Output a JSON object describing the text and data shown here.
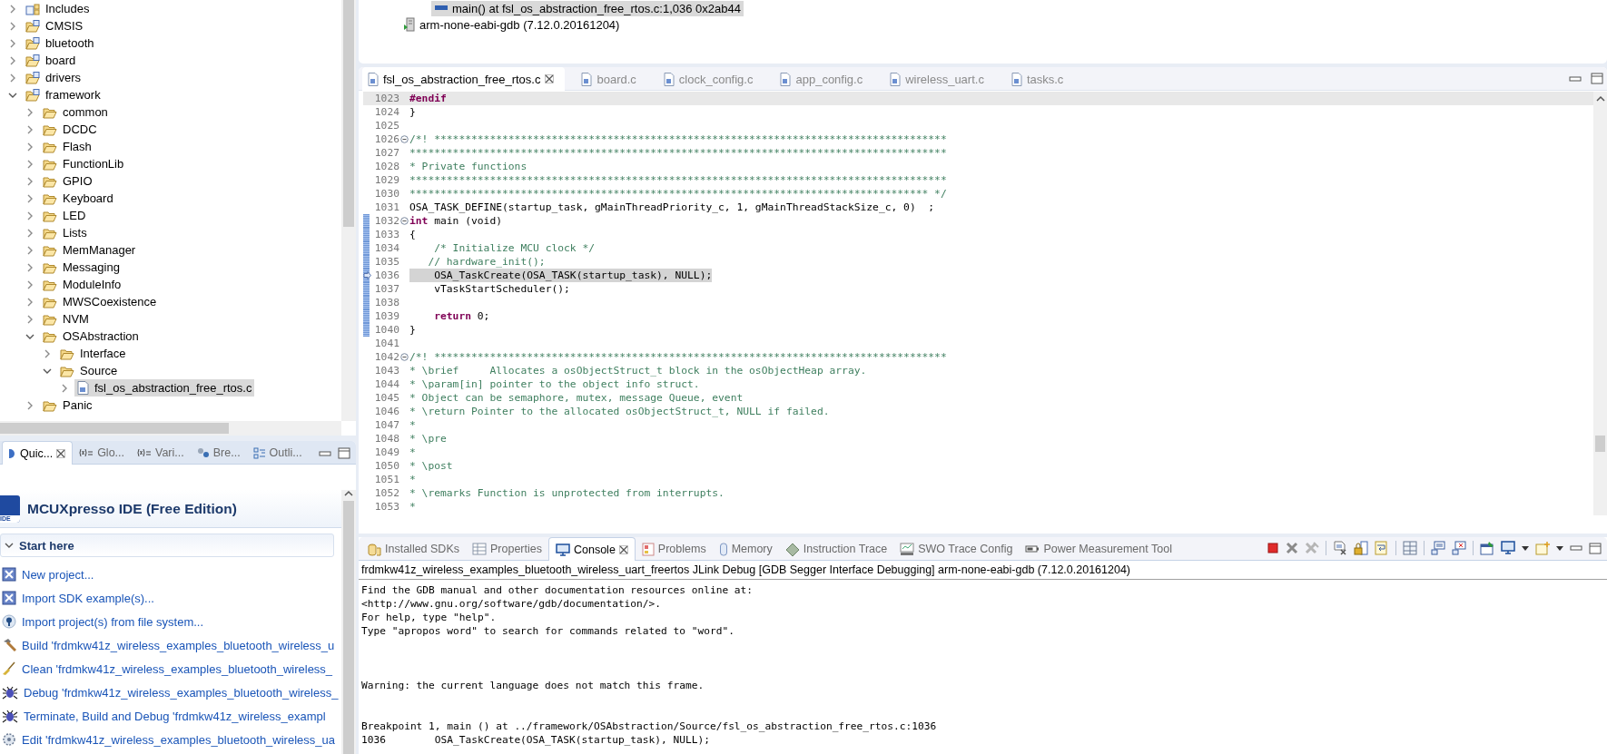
{
  "project_explorer": {
    "items": [
      {
        "label": "Includes",
        "kind": "includes",
        "expanded": false,
        "selected": false
      },
      {
        "label": "CMSIS",
        "kind": "source-folder",
        "expanded": false,
        "selected": false
      },
      {
        "label": "bluetooth",
        "kind": "source-folder",
        "expanded": false,
        "selected": false
      },
      {
        "label": "board",
        "kind": "source-folder",
        "expanded": false,
        "selected": false
      },
      {
        "label": "drivers",
        "kind": "source-folder",
        "expanded": false,
        "selected": false
      },
      {
        "label": "framework",
        "kind": "source-folder",
        "expanded": true,
        "selected": false,
        "children": [
          {
            "label": "common",
            "kind": "folder",
            "expanded": false,
            "selected": false
          },
          {
            "label": "DCDC",
            "kind": "folder",
            "expanded": false,
            "selected": false
          },
          {
            "label": "Flash",
            "kind": "folder",
            "expanded": false,
            "selected": false
          },
          {
            "label": "FunctionLib",
            "kind": "folder",
            "expanded": false,
            "selected": false
          },
          {
            "label": "GPIO",
            "kind": "folder",
            "expanded": false,
            "selected": false
          },
          {
            "label": "Keyboard",
            "kind": "folder",
            "expanded": false,
            "selected": false
          },
          {
            "label": "LED",
            "kind": "folder",
            "expanded": false,
            "selected": false
          },
          {
            "label": "Lists",
            "kind": "folder",
            "expanded": false,
            "selected": false
          },
          {
            "label": "MemManager",
            "kind": "folder",
            "expanded": false,
            "selected": false
          },
          {
            "label": "Messaging",
            "kind": "folder",
            "expanded": false,
            "selected": false
          },
          {
            "label": "ModuleInfo",
            "kind": "folder",
            "expanded": false,
            "selected": false
          },
          {
            "label": "MWSCoexistence",
            "kind": "folder",
            "expanded": false,
            "selected": false
          },
          {
            "label": "NVM",
            "kind": "folder",
            "expanded": false,
            "selected": false
          },
          {
            "label": "OSAbstraction",
            "kind": "folder",
            "expanded": true,
            "selected": false,
            "children": [
              {
                "label": "Interface",
                "kind": "folder",
                "expanded": false,
                "selected": false
              },
              {
                "label": "Source",
                "kind": "folder",
                "expanded": true,
                "selected": false,
                "children": [
                  {
                    "label": "fsl_os_abstraction_free_rtos.c",
                    "kind": "file",
                    "expanded": false,
                    "selected": true
                  }
                ]
              }
            ]
          },
          {
            "label": "Panic",
            "kind": "folder",
            "expanded": false,
            "selected": false
          }
        ]
      }
    ]
  },
  "side_views": {
    "tabs": [
      {
        "label": "Quic...",
        "kind": "quickstart",
        "selected": true
      },
      {
        "label": "Glo...",
        "kind": "variables",
        "selected": false
      },
      {
        "label": "Vari...",
        "kind": "variables",
        "selected": false
      },
      {
        "label": "Bre...",
        "kind": "breakpoints",
        "selected": false
      },
      {
        "label": "Outli...",
        "kind": "outline",
        "selected": false
      }
    ]
  },
  "quick_start": {
    "logo_text": "IDE",
    "title": "MCUXpresso IDE (Free Edition)",
    "section": "Start here",
    "section_expanded": true,
    "actions": [
      {
        "label": "New project...",
        "kind": "new"
      },
      {
        "label": "Import SDK example(s)...",
        "kind": "new"
      },
      {
        "label": "Import project(s) from file system...",
        "kind": "import"
      },
      {
        "label": "Build 'frdmkw41z_wireless_examples_bluetooth_wireless_u",
        "kind": "build"
      },
      {
        "label": "Clean 'frdmkw41z_wireless_examples_bluetooth_wireless_",
        "kind": "clean"
      },
      {
        "label": "Debug 'frdmkw41z_wireless_examples_bluetooth_wireless_",
        "kind": "debug"
      },
      {
        "label": "Terminate, Build and Debug 'frdmkw41z_wireless_exampl",
        "kind": "debug"
      },
      {
        "label": "Edit 'frdmkw41z_wireless_examples_bluetooth_wireless_ua",
        "kind": "edit"
      }
    ]
  },
  "debug_view": {
    "rows": [
      {
        "label": "main() at fsl_os_abstraction_free_rtos.c:1,036 0x2ab44",
        "kind": "frame",
        "selected": true
      },
      {
        "label": "arm-none-eabi-gdb (7.12.0.20161204)",
        "kind": "gdb",
        "selected": false
      }
    ]
  },
  "editor": {
    "tabs": [
      {
        "label": "fsl_os_abstraction_free_rtos.c",
        "selected": true
      },
      {
        "label": "board.c",
        "selected": false
      },
      {
        "label": "clock_config.c",
        "selected": false
      },
      {
        "label": "app_config.c",
        "selected": false
      },
      {
        "label": "wireless_uart.c",
        "selected": false
      },
      {
        "label": "tasks.c",
        "selected": false
      }
    ],
    "lines": [
      {
        "number": "1023",
        "fold": false,
        "current_line": true,
        "in_range": false,
        "instruction_pointer": false,
        "segments": [
          {
            "kind": "preproc",
            "text": "#endif"
          }
        ]
      },
      {
        "number": "1024",
        "fold": false,
        "current_line": false,
        "in_range": false,
        "instruction_pointer": false,
        "segments": [
          {
            "kind": "code",
            "text": "}"
          }
        ]
      },
      {
        "number": "1025",
        "fold": false,
        "current_line": false,
        "in_range": false,
        "instruction_pointer": false
      },
      {
        "number": "1026",
        "fold": true,
        "current_line": false,
        "in_range": false,
        "instruction_pointer": false,
        "segments": [
          {
            "kind": "comment",
            "text": "/*! ***********************************************************************************"
          }
        ]
      },
      {
        "number": "1027",
        "fold": false,
        "current_line": false,
        "in_range": false,
        "instruction_pointer": false,
        "segments": [
          {
            "kind": "comment",
            "text": "***************************************************************************************"
          }
        ]
      },
      {
        "number": "1028",
        "fold": false,
        "current_line": false,
        "in_range": false,
        "instruction_pointer": false,
        "segments": [
          {
            "kind": "comment",
            "text": "* Private functions"
          }
        ]
      },
      {
        "number": "1029",
        "fold": false,
        "current_line": false,
        "in_range": false,
        "instruction_pointer": false,
        "segments": [
          {
            "kind": "comment",
            "text": "***************************************************************************************"
          }
        ]
      },
      {
        "number": "1030",
        "fold": false,
        "current_line": false,
        "in_range": false,
        "instruction_pointer": false,
        "segments": [
          {
            "kind": "comment",
            "text": "************************************************************************************ */"
          }
        ]
      },
      {
        "number": "1031",
        "fold": false,
        "current_line": false,
        "in_range": false,
        "instruction_pointer": false,
        "segments": [
          {
            "kind": "code",
            "text": "OSA_TASK_DEFINE(startup_task, gMainThreadPriority_c, 1, gMainThreadStackSize_c, 0)  ;"
          }
        ]
      },
      {
        "number": "1032",
        "fold": true,
        "current_line": false,
        "in_range": true,
        "instruction_pointer": false,
        "segments": [
          {
            "kind": "keyword",
            "text": "int"
          },
          {
            "kind": "code",
            "text": " main (void)"
          }
        ]
      },
      {
        "number": "1033",
        "fold": false,
        "current_line": false,
        "in_range": true,
        "instruction_pointer": false,
        "segments": [
          {
            "kind": "code",
            "text": "{"
          }
        ]
      },
      {
        "number": "1034",
        "fold": false,
        "current_line": false,
        "in_range": true,
        "instruction_pointer": false,
        "segments": [
          {
            "kind": "comment",
            "text": "    /* Initialize MCU clock */"
          }
        ]
      },
      {
        "number": "1035",
        "fold": false,
        "current_line": false,
        "in_range": true,
        "instruction_pointer": false,
        "segments": [
          {
            "kind": "comment",
            "text": "   // hardware_init();"
          }
        ]
      },
      {
        "number": "1036",
        "fold": false,
        "current_line": false,
        "in_range": true,
        "instruction_pointer": true,
        "segments": [
          {
            "kind": "code",
            "text": "    OSA_TaskCreate(OSA_TASK(startup_task), NULL);"
          }
        ]
      },
      {
        "number": "1037",
        "fold": false,
        "current_line": false,
        "in_range": true,
        "instruction_pointer": false,
        "segments": [
          {
            "kind": "code",
            "text": "    vTaskStartScheduler();"
          }
        ]
      },
      {
        "number": "1038",
        "fold": false,
        "current_line": false,
        "in_range": true,
        "instruction_pointer": false
      },
      {
        "number": "1039",
        "fold": false,
        "current_line": false,
        "in_range": true,
        "instruction_pointer": false,
        "segments": [
          {
            "kind": "keyword",
            "text": "    return"
          },
          {
            "kind": "code",
            "text": " 0;"
          }
        ]
      },
      {
        "number": "1040",
        "fold": false,
        "current_line": false,
        "in_range": true,
        "instruction_pointer": false,
        "segments": [
          {
            "kind": "code",
            "text": "}"
          }
        ]
      },
      {
        "number": "1041",
        "fold": false,
        "current_line": false,
        "in_range": false,
        "instruction_pointer": false
      },
      {
        "number": "1042",
        "fold": true,
        "current_line": false,
        "in_range": false,
        "instruction_pointer": false,
        "segments": [
          {
            "kind": "comment",
            "text": "/*! ***********************************************************************************"
          }
        ]
      },
      {
        "number": "1043",
        "fold": false,
        "current_line": false,
        "in_range": false,
        "instruction_pointer": false,
        "segments": [
          {
            "kind": "comment",
            "text": "* \\brief     Allocates a osObjectStruct_t block in the osObjectHeap array."
          }
        ]
      },
      {
        "number": "1044",
        "fold": false,
        "current_line": false,
        "in_range": false,
        "instruction_pointer": false,
        "segments": [
          {
            "kind": "comment",
            "text": "* \\param[in] pointer to the object info struct."
          }
        ]
      },
      {
        "number": "1045",
        "fold": false,
        "current_line": false,
        "in_range": false,
        "instruction_pointer": false,
        "segments": [
          {
            "kind": "comment",
            "text": "* Object can be semaphore, mutex, message Queue, event"
          }
        ]
      },
      {
        "number": "1046",
        "fold": false,
        "current_line": false,
        "in_range": false,
        "instruction_pointer": false,
        "segments": [
          {
            "kind": "comment",
            "text": "* \\return Pointer to the allocated osObjectStruct_t, NULL if failed."
          }
        ]
      },
      {
        "number": "1047",
        "fold": false,
        "current_line": false,
        "in_range": false,
        "instruction_pointer": false,
        "segments": [
          {
            "kind": "comment",
            "text": "*"
          }
        ]
      },
      {
        "number": "1048",
        "fold": false,
        "current_line": false,
        "in_range": false,
        "instruction_pointer": false,
        "segments": [
          {
            "kind": "comment",
            "text": "* \\pre"
          }
        ]
      },
      {
        "number": "1049",
        "fold": false,
        "current_line": false,
        "in_range": false,
        "instruction_pointer": false,
        "segments": [
          {
            "kind": "comment",
            "text": "*"
          }
        ]
      },
      {
        "number": "1050",
        "fold": false,
        "current_line": false,
        "in_range": false,
        "instruction_pointer": false,
        "segments": [
          {
            "kind": "comment",
            "text": "* \\post"
          }
        ]
      },
      {
        "number": "1051",
        "fold": false,
        "current_line": false,
        "in_range": false,
        "instruction_pointer": false,
        "segments": [
          {
            "kind": "comment",
            "text": "*"
          }
        ]
      },
      {
        "number": "1052",
        "fold": false,
        "current_line": false,
        "in_range": false,
        "instruction_pointer": false,
        "segments": [
          {
            "kind": "comment",
            "text": "* \\remarks Function is unprotected from interrupts."
          }
        ]
      },
      {
        "number": "1053",
        "fold": false,
        "current_line": false,
        "in_range": false,
        "instruction_pointer": false,
        "segments": [
          {
            "kind": "comment",
            "text": "*"
          }
        ]
      }
    ]
  },
  "bottom_views": {
    "tabs": [
      {
        "label": "Installed SDKs",
        "kind": "sdks",
        "selected": false
      },
      {
        "label": "Properties",
        "kind": "properties",
        "selected": false
      },
      {
        "label": "Console",
        "kind": "console",
        "selected": true
      },
      {
        "label": "Problems",
        "kind": "problems",
        "selected": false
      },
      {
        "label": "Memory",
        "kind": "memory",
        "selected": false
      },
      {
        "label": "Instruction Trace",
        "kind": "trace",
        "selected": false
      },
      {
        "label": "SWO Trace Config",
        "kind": "swo",
        "selected": false
      },
      {
        "label": "Power Measurement Tool",
        "kind": "power",
        "selected": false
      }
    ],
    "console": {
      "title": "frdmkw41z_wireless_examples_bluetooth_wireless_uart_freertos JLink Debug [GDB Segger Interface Debugging] arm-none-eabi-gdb (7.12.0.20161204)",
      "lines": [
        {
          "kind": "text",
          "text": "Find the GDB manual and other documentation resources online at:"
        },
        {
          "kind": "text",
          "text": "<http://www.gnu.org/software/gdb/documentation/>."
        },
        {
          "kind": "text",
          "text": "For help, type \"help\"."
        },
        {
          "kind": "text",
          "text": "Type \"apropos word\" to search for commands related to \"word\"."
        },
        {
          "kind": "blank"
        },
        {
          "kind": "blank"
        },
        {
          "kind": "blank"
        },
        {
          "kind": "text",
          "text": "Warning: the current language does not match this frame."
        },
        {
          "kind": "blank"
        },
        {
          "kind": "blank"
        },
        {
          "kind": "text",
          "text": "Breakpoint 1, main () at ../framework/OSAbstraction/Source/fsl_os_abstraction_free_rtos.c:1036"
        },
        {
          "kind": "text",
          "text": "1036        OSA_TaskCreate(OSA_TASK(startup_task), NULL);"
        }
      ]
    }
  }
}
